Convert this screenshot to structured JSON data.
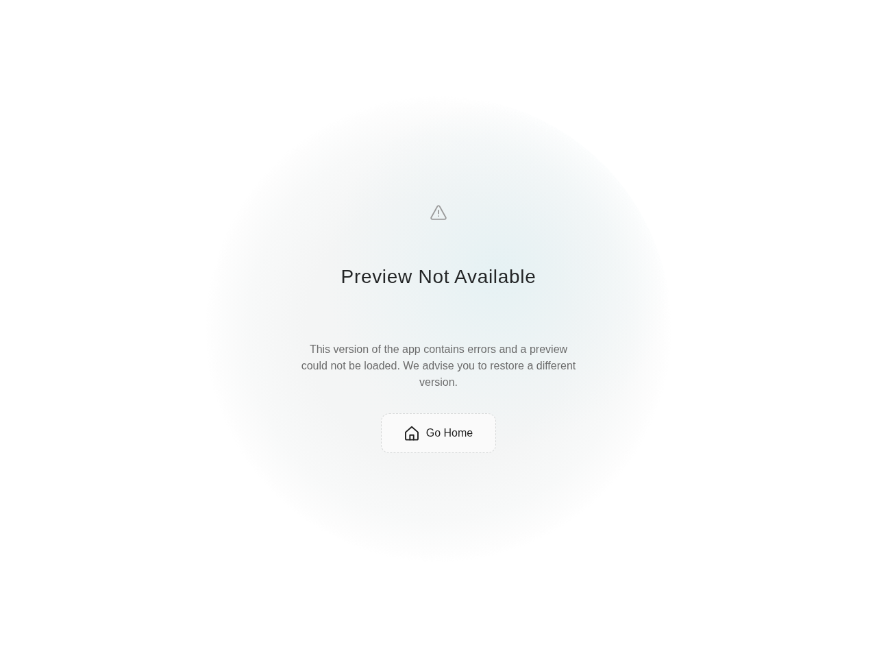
{
  "error_panel": {
    "title": "Preview Not Available",
    "message": "This version of the app contains errors and a preview could not be loaded. We advise you to restore a different version.",
    "button": {
      "label": "Go Home"
    }
  }
}
